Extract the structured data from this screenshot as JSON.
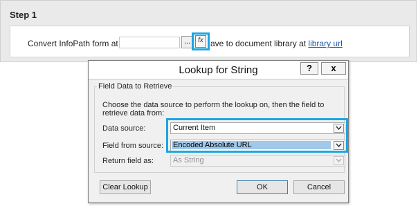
{
  "step": {
    "title": "Step 1",
    "convert_text": "Convert InfoPath form at",
    "ellipsis_label": "...",
    "fx_label": "fx",
    "save_text": "ave to document library at",
    "library_link": "library url"
  },
  "dialog": {
    "title": "Lookup for String",
    "help_label": "?",
    "close_label": "x",
    "group_label": "Field Data to Retrieve",
    "instructions": "Choose the data source to perform the lookup on, then the field to retrieve data from:",
    "data_source": {
      "label": "Data source:",
      "value": "Current Item"
    },
    "field_from_source": {
      "label": "Field from source:",
      "value": "Encoded Absolute URL"
    },
    "return_field_as": {
      "label": "Return field as:",
      "value": "As String"
    },
    "clear_lookup_label": "Clear Lookup",
    "ok_label": "OK",
    "cancel_label": "Cancel"
  },
  "colors": {
    "highlight": "#1aa6e0",
    "link": "#1e5aa8",
    "selection": "#9fc8ea"
  },
  "icons": [
    "ellipsis-button",
    "fx-formula-icon",
    "chevron-down-icon",
    "help-icon",
    "close-icon"
  ]
}
